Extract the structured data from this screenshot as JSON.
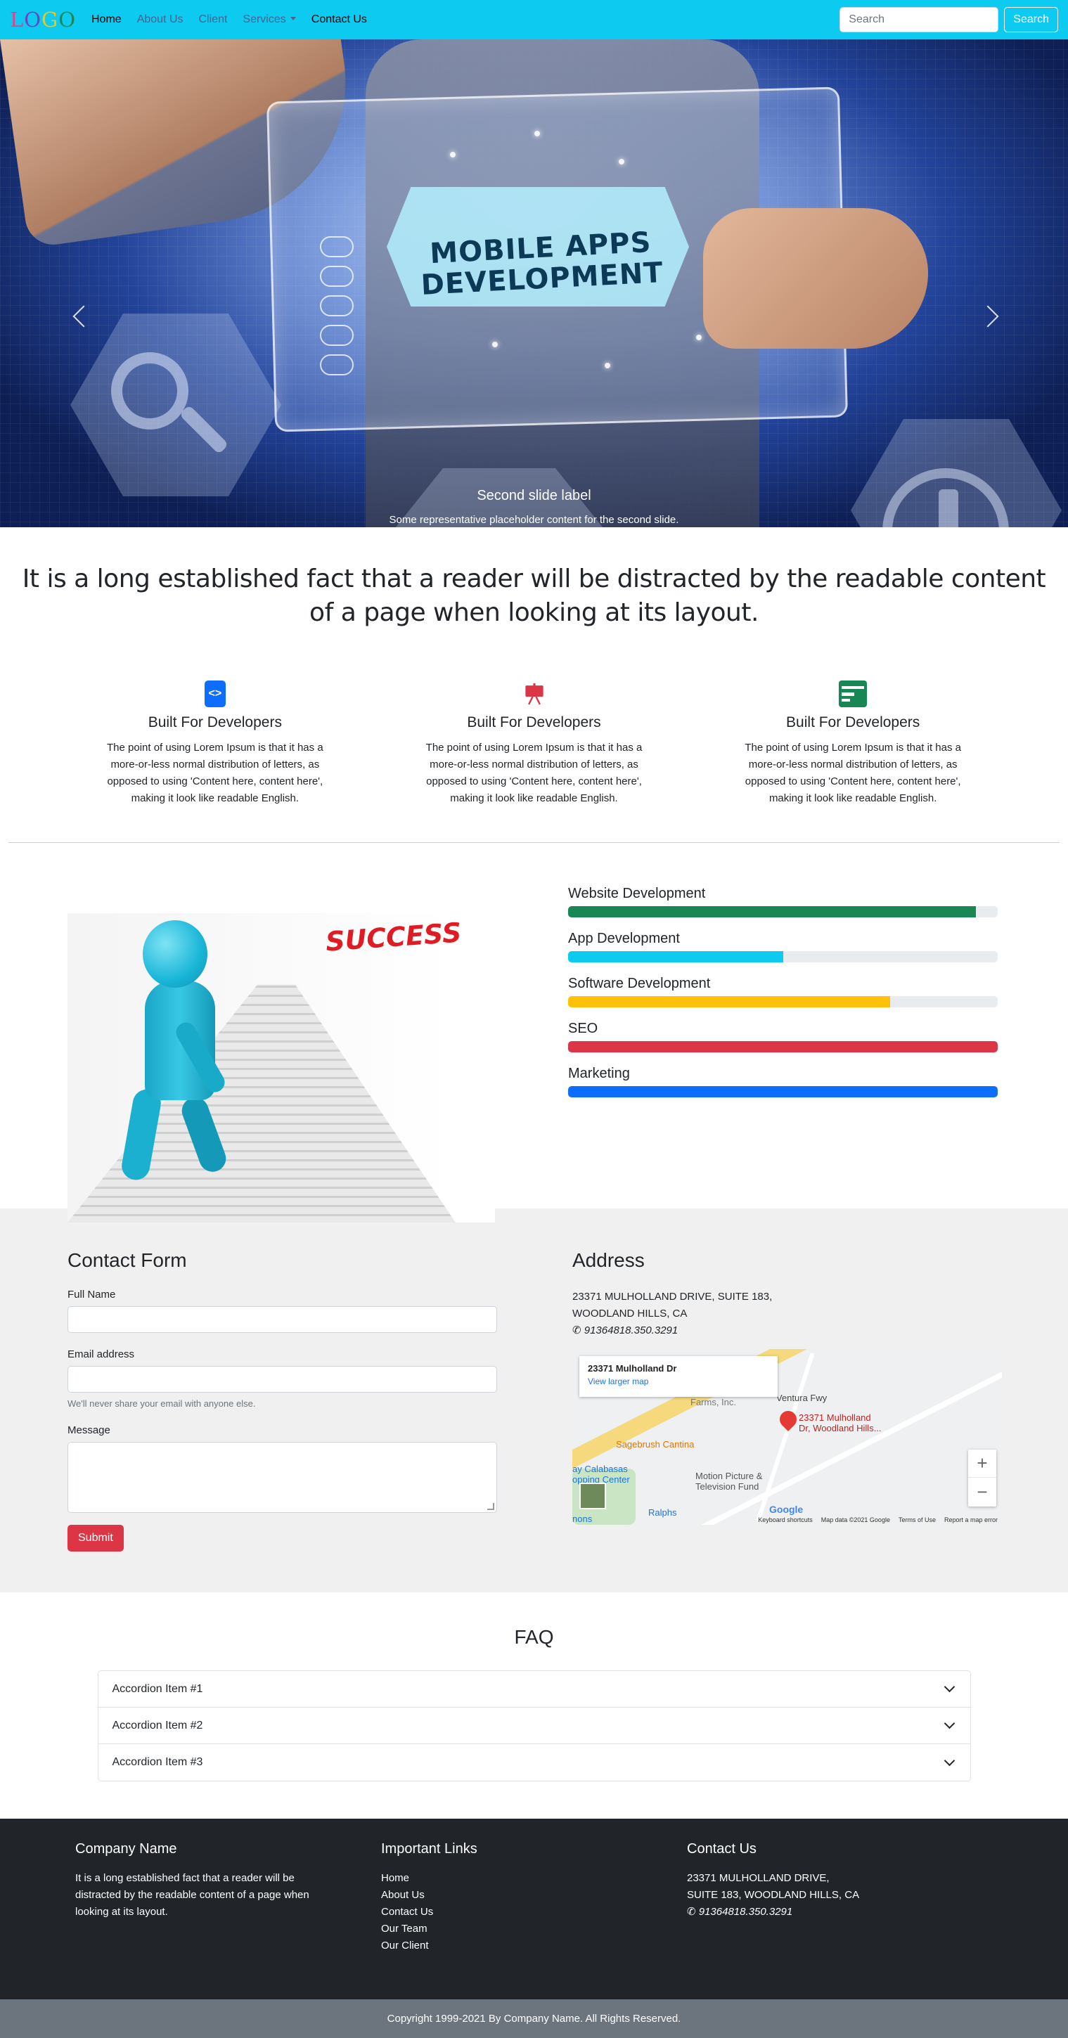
{
  "nav": {
    "logo": [
      "L",
      "O",
      "G",
      "O"
    ],
    "links": [
      "Home",
      "About Us",
      "Client",
      "Services",
      "Contact Us"
    ],
    "search_placeholder": "Search",
    "search_button": "Search"
  },
  "carousel": {
    "image_text": [
      "MOBILE APPS",
      "DEVELOPMENT"
    ],
    "caption_title": "Second slide label",
    "caption_text": "Some representative placeholder content for the second slide.",
    "indicators": 3,
    "active_indicator": 1
  },
  "lead": "It is a long established fact that a reader will be distracted by the readable content of a page when looking at its layout.",
  "features": [
    {
      "icon": "code-icon",
      "color": "#0d6efd",
      "title": "Built For Developers",
      "text": "The point of using Lorem Ipsum is that it has a more-or-less normal distribution of letters, as opposed to using 'Content here, content here', making it look like readable English."
    },
    {
      "icon": "easel-icon",
      "color": "#dc3545",
      "title": "Built For Developers",
      "text": "The point of using Lorem Ipsum is that it has a more-or-less normal distribution of letters, as opposed to using 'Content here, content here', making it look like readable English."
    },
    {
      "icon": "layout-icon",
      "color": "#198754",
      "title": "Built For Developers",
      "text": "The point of using Lorem Ipsum is that it has a more-or-less normal distribution of letters, as opposed to using 'Content here, content here', making it look like readable English."
    }
  ],
  "success_image_text": "SUCCESS",
  "skills": [
    {
      "label": "Website Development",
      "percent": 95,
      "color": "#198754"
    },
    {
      "label": "App Development",
      "percent": 50,
      "color": "#0dcaf0"
    },
    {
      "label": "Software Development",
      "percent": 75,
      "color": "#ffc107"
    },
    {
      "label": "SEO",
      "percent": 100,
      "color": "#dc3545"
    },
    {
      "label": "Marketing",
      "percent": 100,
      "color": "#0d6efd"
    }
  ],
  "contact": {
    "title": "Contact Form",
    "full_name_label": "Full Name",
    "email_label": "Email address",
    "email_hint": "We'll never share your email with anyone else.",
    "message_label": "Message",
    "submit": "Submit"
  },
  "address": {
    "title": "Address",
    "line1": "23371 MULHOLLAND DRIVE, SUITE 183,",
    "line2": "WOODLAND HILLS, CA",
    "phone": "91364818.350.3291",
    "map": {
      "card_title": "23371 Mulholland Dr",
      "card_link": "View larger map",
      "pin_label": [
        "23371 Mulholland",
        "Dr, Woodland Hills..."
      ],
      "labels": [
        "Sagebrush Cantina",
        "Ventura Fwy",
        "Motion Picture &",
        "Television Fund",
        "Ralphs",
        "ay Calabasas",
        "opping Center",
        "nons"
      ],
      "attribution": [
        "Keyboard shortcuts",
        "Map data ©2021 Google",
        "Terms of Use",
        "Report a map error"
      ],
      "brand": "Google"
    }
  },
  "faq": {
    "title": "FAQ",
    "items": [
      "Accordion Item #1",
      "Accordion Item #2",
      "Accordion Item #3"
    ]
  },
  "footer": {
    "company_title": "Company Name",
    "company_text": "It is a long established fact that a reader will be distracted by the readable content of a page when looking at its layout.",
    "links_title": "Important Links",
    "links": [
      "Home",
      "About Us",
      "Contact Us",
      "Our Team",
      "Our Client"
    ],
    "contact_title": "Contact Us",
    "contact_line1": "23371 MULHOLLAND DRIVE,",
    "contact_line2": "SUITE 183, WOODLAND HILLS, CA",
    "contact_phone": "91364818.350.3291",
    "copyright": "Copyright 1999-2021 By Company Name. All Rights Reserved."
  }
}
